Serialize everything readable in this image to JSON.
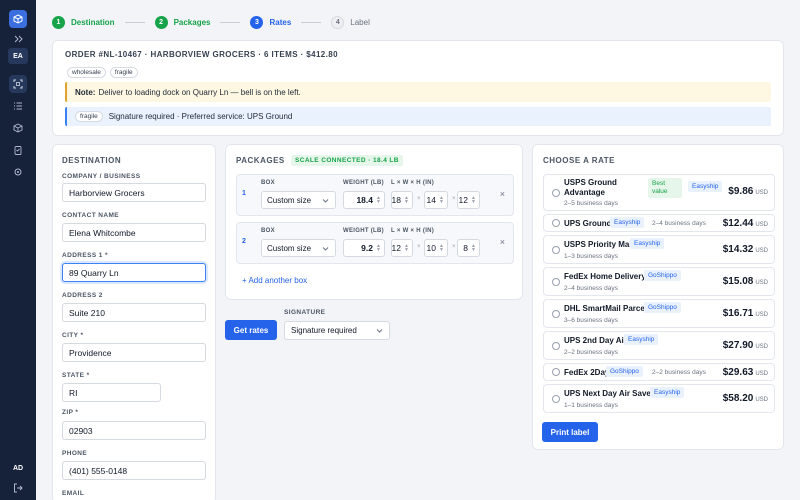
{
  "rail": {
    "user_initials_top": "EA",
    "user_initials_bottom": "AD",
    "active_color": "#26385c",
    "brand_color": "#3b6fe0",
    "icons": [
      "box-logo-icon",
      "expand-icon",
      "scan-icon",
      "list-icon",
      "package-icon",
      "clipboard-icon",
      "gear-icon",
      "logout-icon"
    ]
  },
  "steps": [
    {
      "num": "1",
      "label": "Destination",
      "state": "done"
    },
    {
      "num": "2",
      "label": "Packages",
      "state": "done"
    },
    {
      "num": "3",
      "label": "Rates",
      "state": "current"
    },
    {
      "num": "4",
      "label": "Label",
      "state": "todo"
    }
  ],
  "order": {
    "title": "ORDER #NL-10467 · HARBORVIEW GROCERS · 6 ITEMS · $412.80",
    "tags": [
      "wholesale",
      "fragile"
    ],
    "note_label": "Note:",
    "note_text": "Deliver to loading dock on Quarry Ln — bell is on the left.",
    "info_tag": "fragile",
    "info_text": "Signature required · Preferred service: UPS Ground"
  },
  "destination": {
    "title": "DESTINATION",
    "fields": [
      {
        "label": "COMPANY / BUSINESS",
        "value": "Harborview Grocers",
        "required": false
      },
      {
        "label": "CONTACT NAME",
        "value": "Elena Whitcombe",
        "required": false
      },
      {
        "label": "ADDRESS 1",
        "value": "89 Quarry Ln",
        "required": true
      },
      {
        "label": "ADDRESS 2",
        "value": "Suite 210",
        "required": false
      },
      {
        "label": "CITY",
        "value": "Providence",
        "required": true
      },
      {
        "label": "STATE",
        "value": "RI",
        "required": true
      },
      {
        "label": "ZIP",
        "value": "02903",
        "required": true
      },
      {
        "label": "PHONE",
        "value": "(401) 555-0148",
        "required": false
      },
      {
        "label": "EMAIL",
        "value": "",
        "required": false
      }
    ],
    "required_mark": "*"
  },
  "packages": {
    "title": "PACKAGES",
    "scale_status": "SCALE CONNECTED · 18.4 LB",
    "col_box": "BOX",
    "col_weight": "WEIGHT (LB)",
    "col_dims": "L × W × H (IN)",
    "times": "×",
    "remove": "×",
    "items": [
      {
        "index": "1",
        "box": "Custom size",
        "weight": "18.4",
        "l": "18",
        "w": "14",
        "h": "12"
      },
      {
        "index": "2",
        "box": "Custom size",
        "weight": "9.2",
        "l": "12",
        "w": "10",
        "h": "8"
      }
    ],
    "add_label": "+ Add another box"
  },
  "actions": {
    "get_rates": "Get rates",
    "signature_label": "SIGNATURE",
    "signature_value": "Signature required"
  },
  "rates": {
    "title": "CHOOSE A RATE",
    "currency": "USD",
    "items": [
      {
        "name_line1": "USPS Ground",
        "name_line2": "Advantage",
        "best": "Best value",
        "provider": "Easyship",
        "eta": "2–5 business days",
        "price": "$9.86"
      },
      {
        "name_line1": "UPS Ground",
        "provider": "Easyship",
        "eta": "2–4 business days",
        "price": "$12.44"
      },
      {
        "name_line1": "USPS Priority Mail",
        "provider": "Easyship",
        "eta": "1–3 business days",
        "price": "$14.32"
      },
      {
        "name_line1": "FedEx Home Delivery",
        "provider": "GoShippo",
        "eta": "2–4 business days",
        "price": "$15.08"
      },
      {
        "name_line1": "DHL SmartMail Parcel",
        "provider": "GoShippo",
        "eta": "3–6 business days",
        "price": "$16.71"
      },
      {
        "name_line1": "UPS 2nd Day Air",
        "provider": "Easyship",
        "eta": "2–2 business days",
        "price": "$27.90"
      },
      {
        "name_line1": "FedEx 2Day",
        "provider": "GoShippo",
        "eta": "2–2 business days",
        "price": "$29.63"
      },
      {
        "name_line1": "UPS Next Day Air Saver",
        "provider": "Easyship",
        "eta": "1–1 business days",
        "price": "$58.20"
      }
    ],
    "print_label": "Print label"
  },
  "colors": {
    "accent": "#2563eb",
    "success": "#16a34a",
    "note_bg": "#fef7e2",
    "info_bg": "#e9f2fd"
  }
}
